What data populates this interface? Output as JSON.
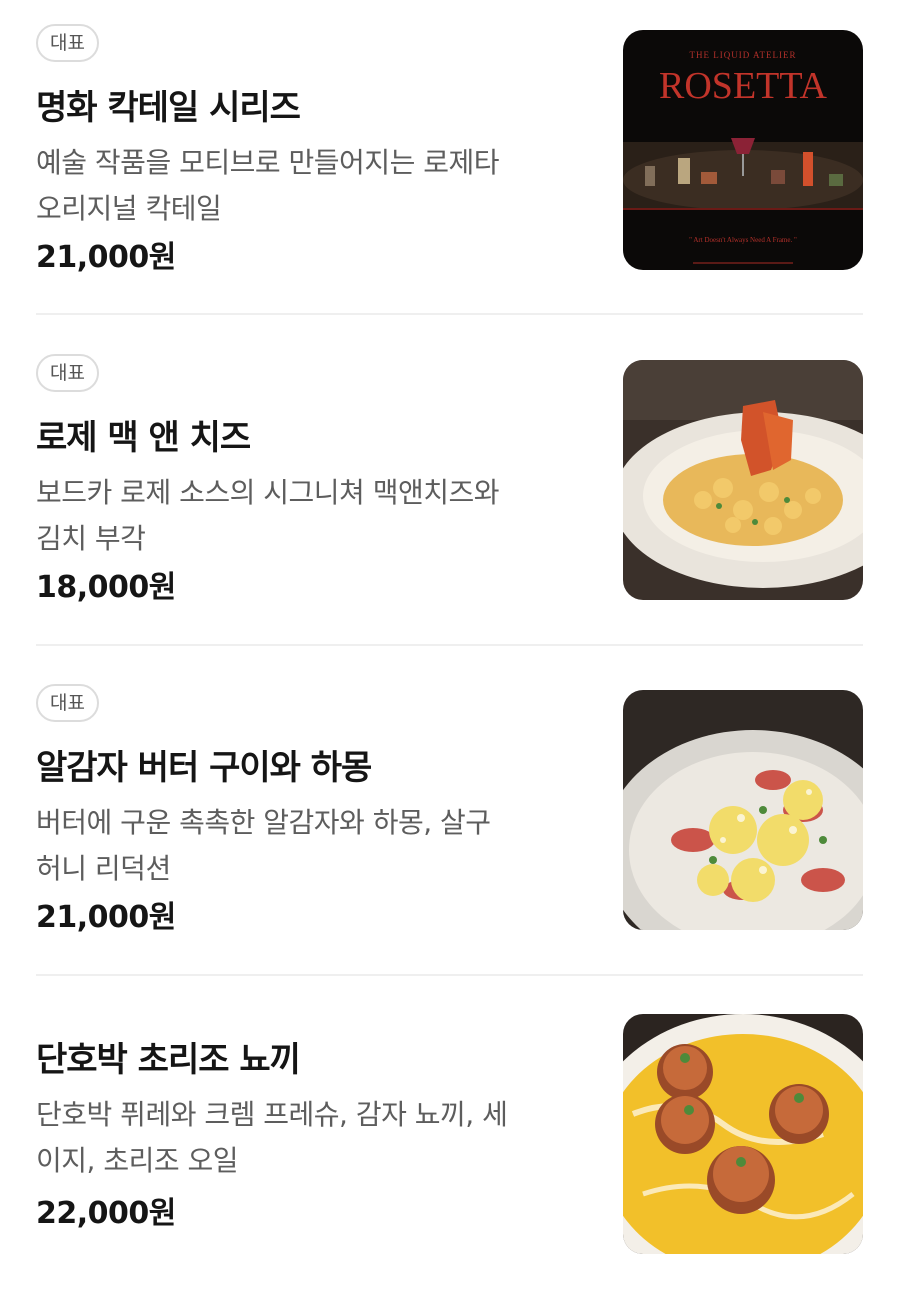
{
  "items": [
    {
      "badge": "대표",
      "name": "명화 칵테일 시리즈",
      "desc_line1": "예술 작품을 모티브로 만들어지는 로제타",
      "desc_line2": "오리지널 칵테일",
      "price": "21,000원",
      "image": {
        "icon": "cocktail-poster-image",
        "top_text": "THE LIQUID ATELIER",
        "title": "ROSETTA",
        "quote": "\" Art Doesn't Always Need A Frame. \""
      }
    },
    {
      "badge": "대표",
      "name": "로제 맥 앤 치즈",
      "desc_line1": "보드카 로제 소스의 시그니쳐 맥앤치즈와",
      "desc_line2": "김치 부각",
      "price": "18,000원",
      "image": {
        "icon": "mac-and-cheese-image"
      }
    },
    {
      "badge": "대표",
      "name": "알감자 버터 구이와 하몽",
      "desc_line1": "버터에 구운 촉촉한 알감자와 하몽, 살구",
      "desc_line2": "허니 리덕션",
      "price": "21,000원",
      "image": {
        "icon": "potato-jamon-image"
      }
    },
    {
      "badge": "",
      "name": "단호박 초리조 뇨끼",
      "desc_line1": "단호박 퓌레와 크렘 프레슈, 감자 뇨끼, 세",
      "desc_line2": "이지, 초리조 오일",
      "price": "22,000원",
      "image": {
        "icon": "pumpkin-gnocchi-image"
      }
    }
  ]
}
